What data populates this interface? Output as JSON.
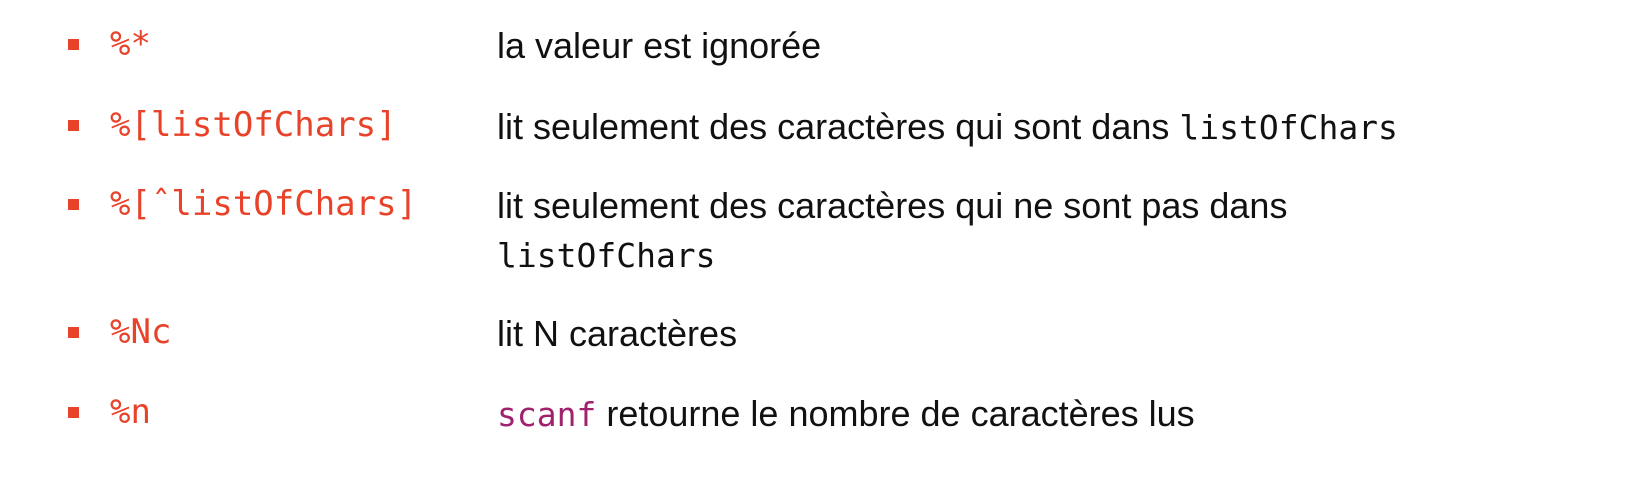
{
  "colors": {
    "accent": "#e8432a",
    "text": "#111111",
    "keyword": "#a0226e"
  },
  "items": [
    {
      "code": "%*",
      "description": "la valeur est ignorée"
    },
    {
      "code": "%[listOfChars]",
      "description_prefix": "lit seulement des caractères qui sont dans ",
      "description_code": "listOfChars"
    },
    {
      "code": "%[ˆlistOfChars]",
      "description_line1": "lit seulement des caractères qui ne sont pas dans",
      "description_line2_code": "listOfChars"
    },
    {
      "code": "%Nc",
      "description": "lit N caractères"
    },
    {
      "code": "%n",
      "description_keyword": "scanf",
      "description_suffix": " retourne le nombre de caractères lus"
    }
  ]
}
